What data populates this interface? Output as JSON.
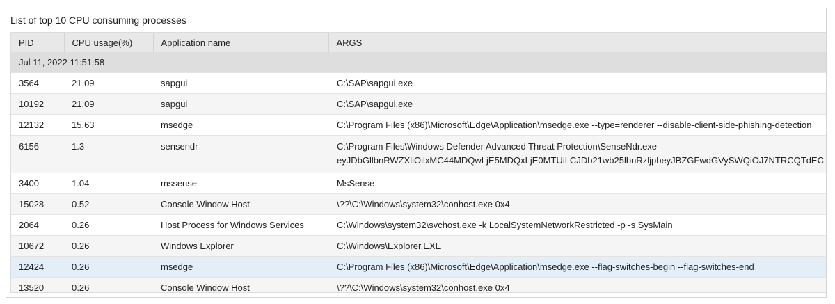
{
  "panel": {
    "title": "List of top 10 CPU consuming processes"
  },
  "table": {
    "columns": [
      "PID",
      "CPU usage(%)",
      "Application name",
      "ARGS"
    ],
    "group_label": "Jul 11, 2022 11:51:58",
    "rows": [
      {
        "pid": "3564",
        "cpu": "21.09",
        "app": "sapgui",
        "args": [
          "C:\\SAP\\sapgui.exe"
        ]
      },
      {
        "pid": "10192",
        "cpu": "21.09",
        "app": "sapgui",
        "args": [
          "C:\\SAP\\sapgui.exe"
        ]
      },
      {
        "pid": "12132",
        "cpu": "15.63",
        "app": "msedge",
        "args": [
          "C:\\Program Files (x86)\\Microsoft\\Edge\\Application\\msedge.exe --type=renderer --disable-client-side-phishing-detection"
        ]
      },
      {
        "pid": "6156",
        "cpu": "1.3",
        "app": "sensendr",
        "args": [
          "C:\\Program Files\\Windows Defender Advanced Threat Protection\\SenseNdr.exe",
          "eyJDbGllbnRWZXliOilxMC44MDQwLjE5MDQxLjE0MTUiLCJDb21wb25lbnRzljpbeyJBZGFwdGVySWQiOJ7NTRCQTdEC"
        ]
      },
      {
        "pid": "3400",
        "cpu": "1.04",
        "app": "mssense",
        "args": [
          "MsSense"
        ]
      },
      {
        "pid": "15028",
        "cpu": "0.52",
        "app": "Console Window Host",
        "args": [
          "\\??\\C:\\Windows\\system32\\conhost.exe 0x4"
        ]
      },
      {
        "pid": "2064",
        "cpu": "0.26",
        "app": "Host Process for Windows Services",
        "args": [
          "C:\\Windows\\system32\\svchost.exe -k LocalSystemNetworkRestricted -p -s SysMain"
        ]
      },
      {
        "pid": "10672",
        "cpu": "0.26",
        "app": "Windows Explorer",
        "args": [
          "C:\\Windows\\Explorer.EXE"
        ]
      },
      {
        "pid": "12424",
        "cpu": "0.26",
        "app": "msedge",
        "args": [
          "C:\\Program Files (x86)\\Microsoft\\Edge\\Application\\msedge.exe --flag-switches-begin --flag-switches-end"
        ]
      },
      {
        "pid": "13520",
        "cpu": "0.26",
        "app": "Console Window Host",
        "args": [
          "\\??\\C:\\Windows\\system32\\conhost.exe 0x4"
        ]
      }
    ]
  }
}
